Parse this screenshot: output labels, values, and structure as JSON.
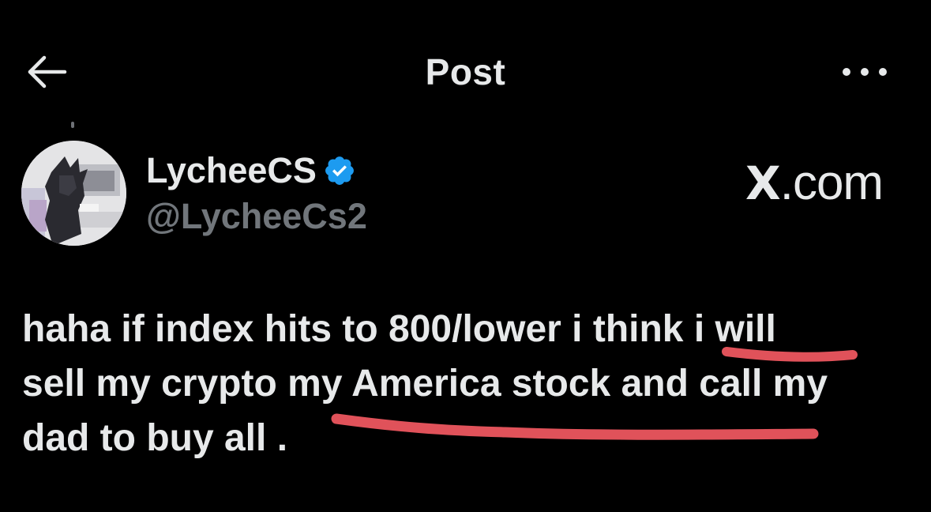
{
  "header": {
    "title": "Post",
    "back_icon": "arrow-left-icon",
    "more_icon": "more-horizontal-icon"
  },
  "author": {
    "display_name": "LycheeCS",
    "handle": "@LycheeCs2",
    "verified_icon": "verified-badge-icon",
    "verified_color": "#1d9bf0"
  },
  "watermark": {
    "x_glyph": "X",
    "rest": ".com"
  },
  "post": {
    "lines": [
      "haha if index hits to 800/lower i think i will",
      "sell my crypto my America stock and call my",
      "dad to buy all ."
    ]
  },
  "colors": {
    "background": "#000000",
    "text_primary": "#e7e9ea",
    "text_secondary": "#71767b",
    "annotation": "#e0525a"
  }
}
